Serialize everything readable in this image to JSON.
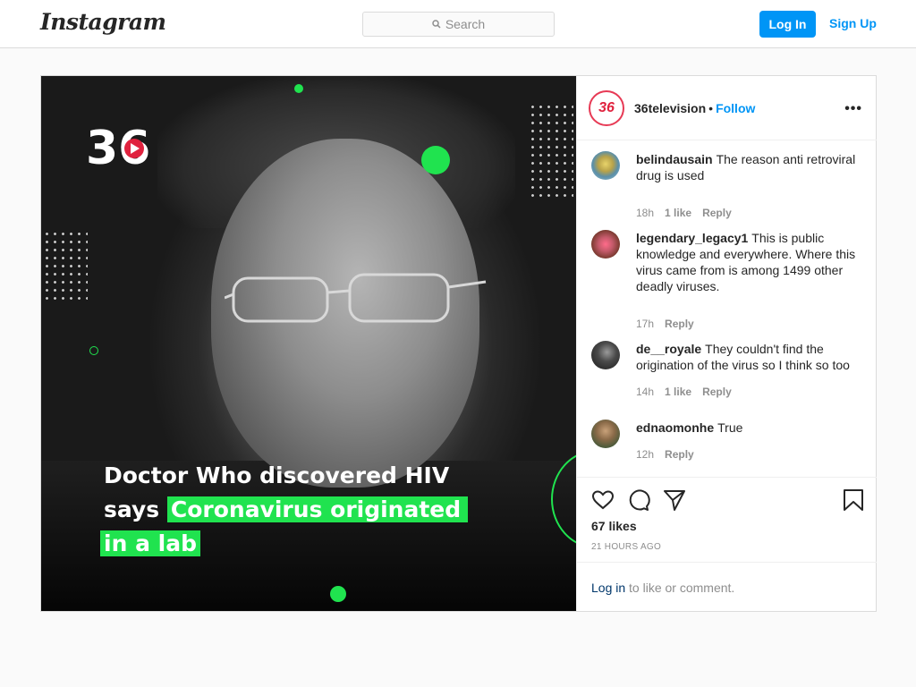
{
  "nav": {
    "logo": "Instagram",
    "search_placeholder": "Search",
    "login_label": "Log In",
    "signup_label": "Sign Up"
  },
  "post": {
    "brand_mark": "36",
    "headline": {
      "line1": "Doctor Who discovered HIV",
      "line2_plain": "says ",
      "line2_highlight": "Coronavirus originated",
      "line3_highlight": "in a lab"
    },
    "accent_color": "#20e34f"
  },
  "header": {
    "avatar_text": "36",
    "username": "36television",
    "separator": "•",
    "follow_label": "Follow",
    "more_label": "•••"
  },
  "comments": [
    {
      "username": "belindausain",
      "text": "The reason anti retroviral drug is used",
      "time": "18h",
      "likes": "1 like",
      "reply": "Reply",
      "avatar_color": "#5b8fa8"
    },
    {
      "username": "legendary_legacy1",
      "text": "This is public knowledge and everywhere. Where this virus came from is among 1499 other deadly viruses.",
      "time": "17h",
      "likes": "",
      "reply": "Reply",
      "avatar_color": "#c45a6a"
    },
    {
      "username": "de__royale",
      "text": "They couldn't find the origination of the virus so I think so too",
      "time": "14h",
      "likes": "1 like",
      "reply": "Reply",
      "avatar_color": "#2a2a2a"
    },
    {
      "username": "ednaomonhe",
      "text": "True",
      "time": "12h",
      "likes": "",
      "reply": "Reply",
      "avatar_color": "#6b5a3e"
    }
  ],
  "actions": {
    "likes": "67 likes",
    "time_ago": "21 HOURS AGO",
    "login_link": "Log in",
    "login_suffix": " to like or comment."
  }
}
